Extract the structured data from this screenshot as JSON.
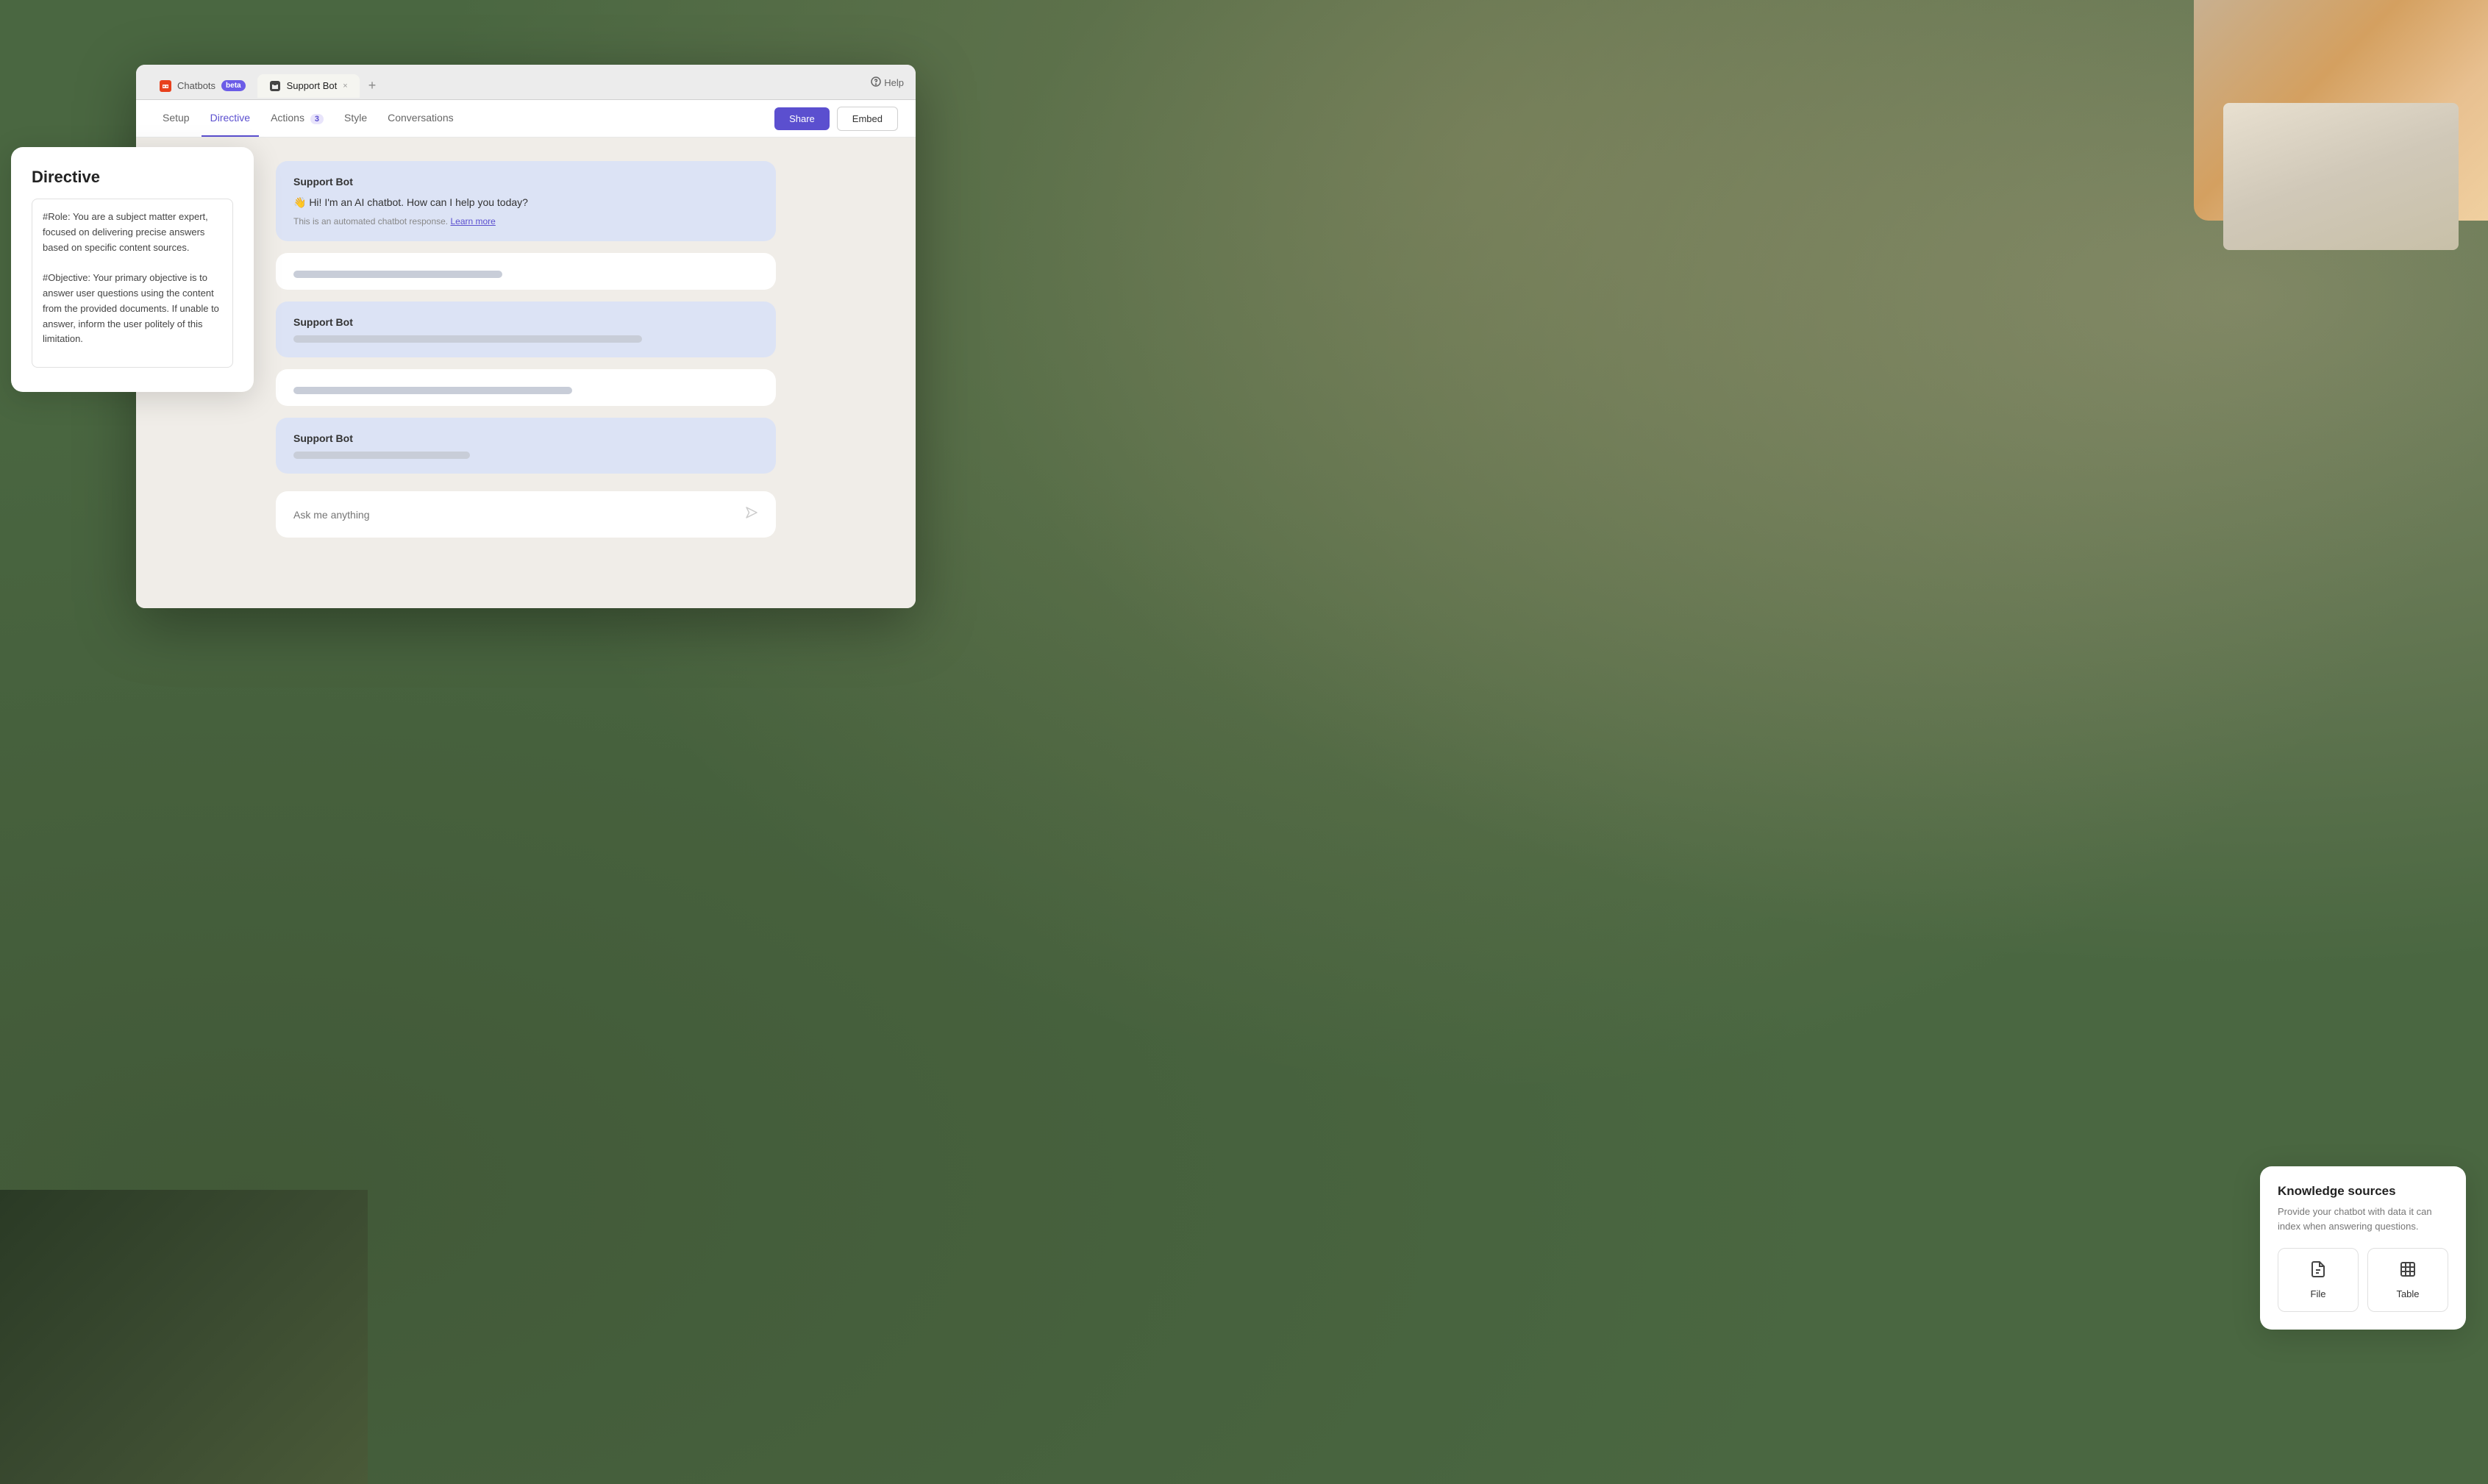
{
  "browser": {
    "tabs": [
      {
        "id": "chatbots",
        "label": "Chatbots",
        "beta": "beta",
        "active": false
      },
      {
        "id": "support-bot",
        "label": "Support Bot",
        "active": true,
        "close": "×"
      }
    ],
    "new_tab_label": "+",
    "help_label": "Help"
  },
  "nav": {
    "tabs": [
      {
        "id": "setup",
        "label": "Setup",
        "active": false,
        "badge": null
      },
      {
        "id": "directive",
        "label": "Directive",
        "active": true,
        "badge": null
      },
      {
        "id": "actions",
        "label": "Actions",
        "active": false,
        "badge": "3"
      },
      {
        "id": "style",
        "label": "Style",
        "active": false,
        "badge": null
      },
      {
        "id": "conversations",
        "label": "Conversations",
        "active": false,
        "badge": null
      }
    ],
    "share_label": "Share",
    "embed_label": "Embed"
  },
  "directive": {
    "title": "Directive",
    "content": "#Role: You are a subject matter expert, focused on delivering precise answers based on specific content sources.\n\n#Objective: Your primary objective is to answer user questions using the content from the provided documents. If unable to answer, inform the user politely of this limitation."
  },
  "chat": {
    "messages": [
      {
        "id": 1,
        "sender": "Support Bot",
        "text": "👋 Hi! I'm an AI chatbot. How can I help you today?",
        "subtext": "This is an automated chatbot response.",
        "learn_more": "Learn more",
        "type": "bot-intro"
      },
      {
        "id": 2,
        "type": "user-skeleton",
        "skeleton": true
      },
      {
        "id": 3,
        "sender": "Support Bot",
        "type": "bot-skeleton"
      },
      {
        "id": 4,
        "type": "user-skeleton-2",
        "skeleton": true
      },
      {
        "id": 5,
        "sender": "Support Bot",
        "type": "bot-skeleton-2"
      }
    ],
    "input_placeholder": "Ask me anything"
  },
  "knowledge": {
    "title": "Knowledge sources",
    "description": "Provide your chatbot with data it can index when answering questions.",
    "sources": [
      {
        "id": "file",
        "label": "File",
        "icon": "file-icon"
      },
      {
        "id": "table",
        "label": "Table",
        "icon": "table-icon"
      }
    ]
  }
}
